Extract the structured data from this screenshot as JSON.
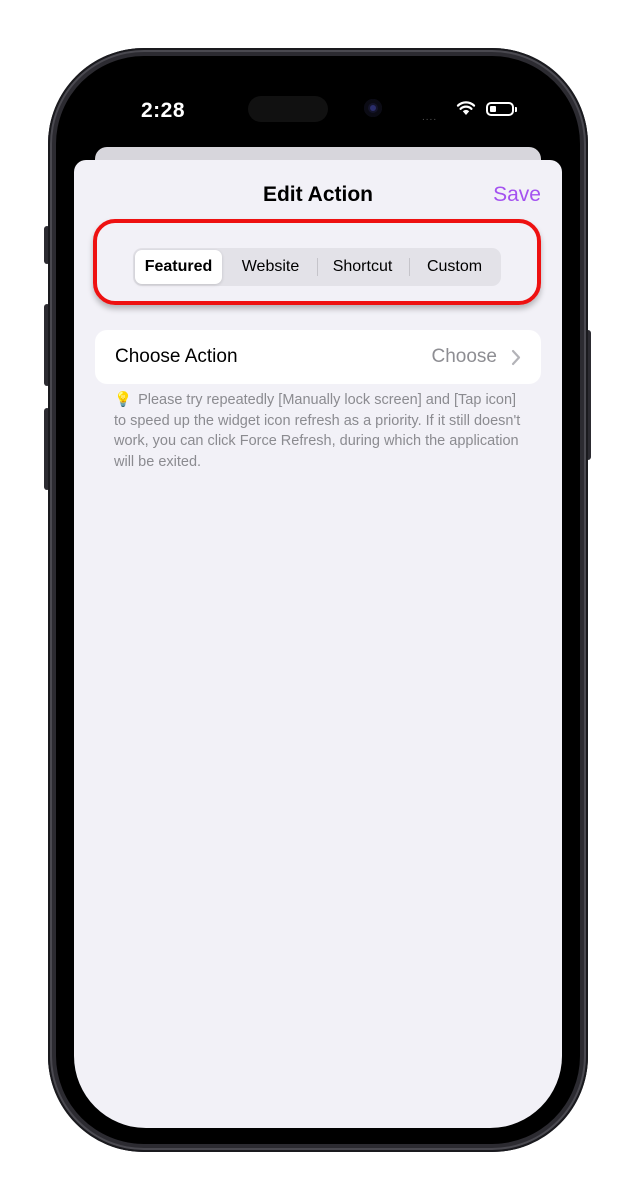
{
  "status_bar": {
    "time": "2:28",
    "signal": "....",
    "wifi_icon": "wifi-icon",
    "battery_icon": "battery-icon"
  },
  "header": {
    "title": "Edit Action",
    "save_label": "Save"
  },
  "segments": [
    {
      "label": "Featured",
      "selected": true
    },
    {
      "label": "Website",
      "selected": false
    },
    {
      "label": "Shortcut",
      "selected": false
    },
    {
      "label": "Custom",
      "selected": false
    }
  ],
  "action_row": {
    "label": "Choose Action",
    "value": "Choose"
  },
  "note": {
    "icon": "💡",
    "text": "Please try repeatedly [Manually lock screen] and [Tap icon] to speed up the widget icon refresh as a priority. If it still doesn't work, you can click Force Refresh, during which the application will be exited."
  },
  "colors": {
    "accent": "#a452f0",
    "highlight": "#ee1111",
    "sheet_background": "#f2f1f7"
  }
}
